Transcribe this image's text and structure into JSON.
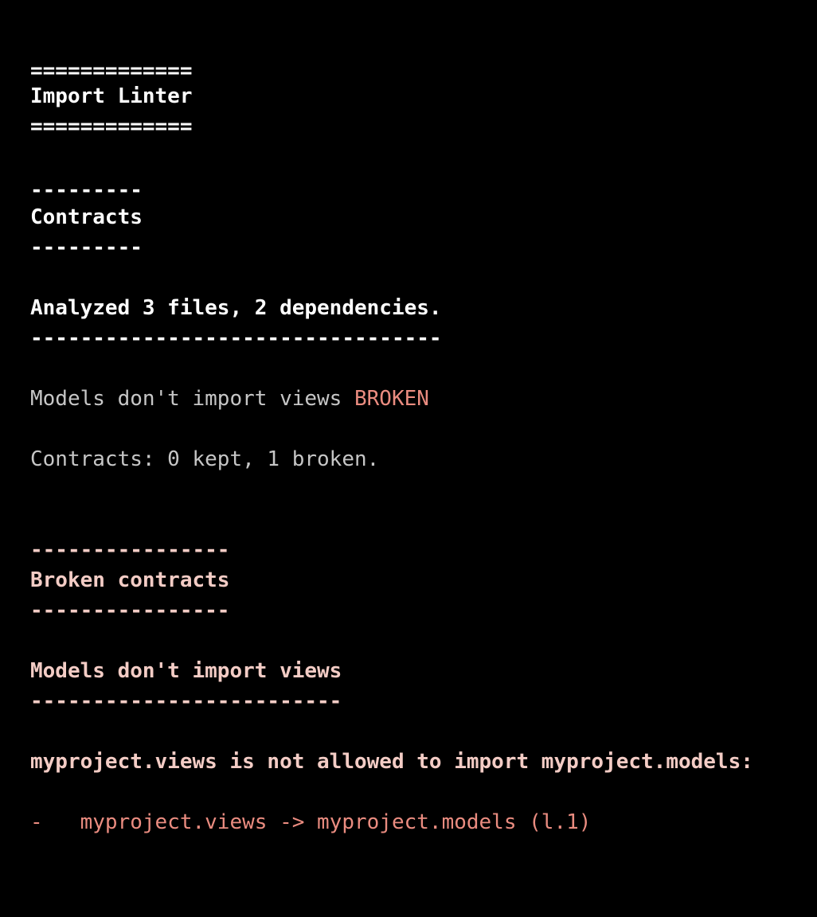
{
  "terminal": {
    "background_color": "#000000",
    "colors": {
      "white": "#ffffff",
      "grey": "#c6c6c6",
      "pink": "#f3ccc5",
      "salmon": "#ea8c80"
    },
    "report": {
      "title": "Import Linter",
      "title_rule": "=============",
      "contracts_section": {
        "heading": "Contracts",
        "rule": "---------"
      },
      "summary": {
        "analyzed_line": "Analyzed 3 files, 2 dependencies.",
        "analyzed_rule": "---------------------------------",
        "contract_results": [
          {
            "name": "Models don't import views",
            "status": "BROKEN"
          }
        ],
        "totals_line": "Contracts: 0 kept, 1 broken."
      },
      "broken_section": {
        "heading": "Broken contracts",
        "rule": "----------------",
        "contract": {
          "heading": "Models don't import views",
          "rule": "-------------------------",
          "violation_header": "myproject.views is not allowed to import myproject.models:",
          "chains": [
            {
              "bullet": "-",
              "text": "myproject.views -> myproject.models (l.1)"
            }
          ]
        }
      }
    }
  }
}
